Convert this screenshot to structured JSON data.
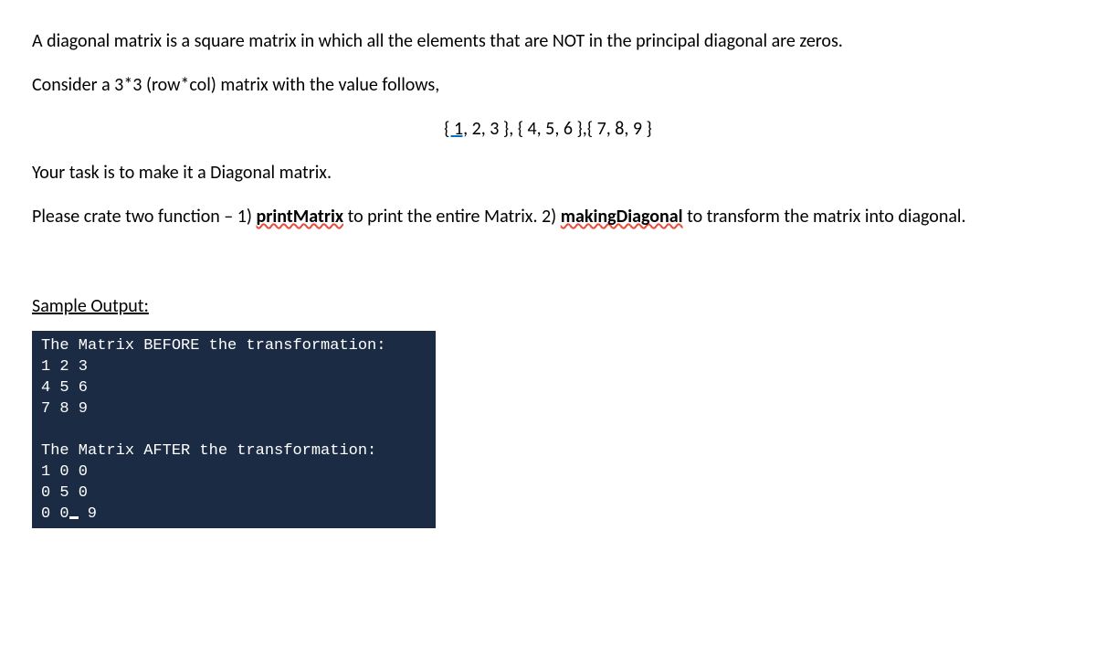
{
  "para1": "A diagonal matrix is a square matrix in which all the elements that are NOT in the principal diagonal are zeros.",
  "para2": "Consider a 3*3 (row*col) matrix with the value follows,",
  "matrix_underlined": "{ 1,",
  "matrix_rest": " 2, 3 }, { 4, 5, 6 },{ 7, 8, 9 }",
  "para3": "Your task is to make it a Diagonal matrix.",
  "para4_a": "Please crate two function – 1) ",
  "para4_b": "printMatrix",
  "para4_c": " to print the entire Matrix. 2) ",
  "para4_d": "makingDiagonal",
  "para4_e": " to transform the matrix into diagonal.",
  "sample_output_label": "Sample Output:",
  "terminal": {
    "line1": "The Matrix BEFORE the transformation:",
    "line2": "1 2 3",
    "line3": "4 5 6",
    "line4": "7 8 9",
    "blank": " ",
    "line5": "The Matrix AFTER the transformation:",
    "line6": "1 0 0",
    "line7": "0 5 0",
    "line8a": "0 0",
    "line8b": " 9"
  }
}
